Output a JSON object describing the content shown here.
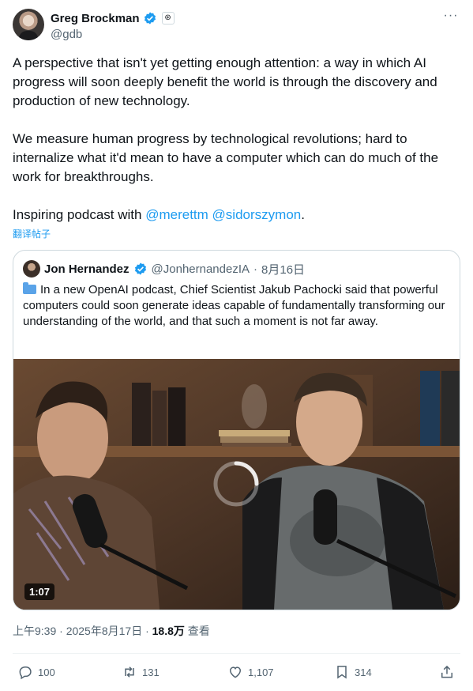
{
  "author": {
    "name": "Greg Brockman",
    "handle": "@gdb"
  },
  "tweet": {
    "text_main": "A perspective that isn't yet getting enough attention: a way in which AI progress will soon deeply benefit the world is through the discovery and production of new technology.\n\nWe measure human progress by technological revolutions; hard to internalize what it'd mean to have a computer which can do much of the work for breakthroughs.\n\nInspiring podcast with ",
    "mention1": "@merettm",
    "mention2": "@sidorszymon",
    "end": ".",
    "translate": "翻译帖子"
  },
  "quote": {
    "name": "Jon Hernandez",
    "handle": "@JonhernandezIA",
    "sep": "·",
    "date": "8月16日",
    "text": "In a new OpenAI podcast, Chief Scientist Jakub Pachocki said that powerful computers could soon generate ideas capable of fundamentally transforming our understanding of the world, and that such a moment is not far away.",
    "video_duration": "1:07"
  },
  "meta": {
    "time": "上午9:39 · 2025年8月17日 · ",
    "views": "18.8万",
    "views_label": " 查看"
  },
  "actions": {
    "replies": "100",
    "reposts": "131",
    "likes": "1,107",
    "bookmarks": "314"
  },
  "colors": {
    "accent": "#1d9bf0",
    "muted": "#536471",
    "text": "#0f1419"
  },
  "icons": [
    "verified-badge-icon",
    "organization-badge-icon",
    "more-icon",
    "folder-icon",
    "loading-spinner-icon",
    "reply-icon",
    "repost-icon",
    "like-icon",
    "bookmark-icon",
    "share-icon"
  ]
}
